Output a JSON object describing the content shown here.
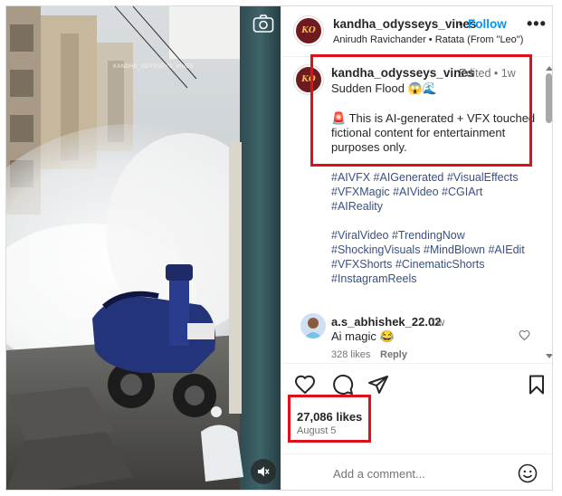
{
  "media": {
    "watermark": "KANDHA_ODYSSEYS_VINES",
    "camera_icon": "camera-icon",
    "mute_icon": "speaker-muted-icon"
  },
  "header": {
    "username": "kandha_odysseys_vines",
    "separator": "•",
    "follow_label": "Follow",
    "audio": "Anirudh Ravichander • Ratata (From \"Leo\")",
    "more_icon": "more-horizontal-icon"
  },
  "caption": {
    "avatar_text": "KO",
    "username": "kandha_odysseys_vines",
    "meta": "Edited • 1w",
    "title": "Sudden Flood 😱🌊",
    "notice_lines": [
      "🚨 This is AI-generated + VFX touched",
      "fictional content for entertainment",
      "purposes only."
    ],
    "hashtags_1": [
      "#AIVFX #AIGenerated #VisualEffects",
      "#VFXMagic #AIVideo #CGIArt",
      "#AIReality"
    ],
    "hashtags_2": [
      "#ViralVideo #TrendingNow",
      "#ShockingVisuals #MindBlown #AIEdit",
      "#VFXShorts #CinematicShorts",
      "#InstagramReels"
    ]
  },
  "comment": {
    "username": "a.s_abhishek_22.02",
    "time": "1w",
    "text": "Ai magic 😂",
    "likes": "328 likes",
    "reply_label": "Reply"
  },
  "actions": {
    "likes": "27,086 likes",
    "date": "August 5"
  },
  "add_comment": {
    "placeholder": "Add a comment..."
  },
  "colors": {
    "link_blue": "#0095f6",
    "hashtag": "#385185",
    "highlight_box": "#e0101a",
    "muted_text": "#737373"
  }
}
